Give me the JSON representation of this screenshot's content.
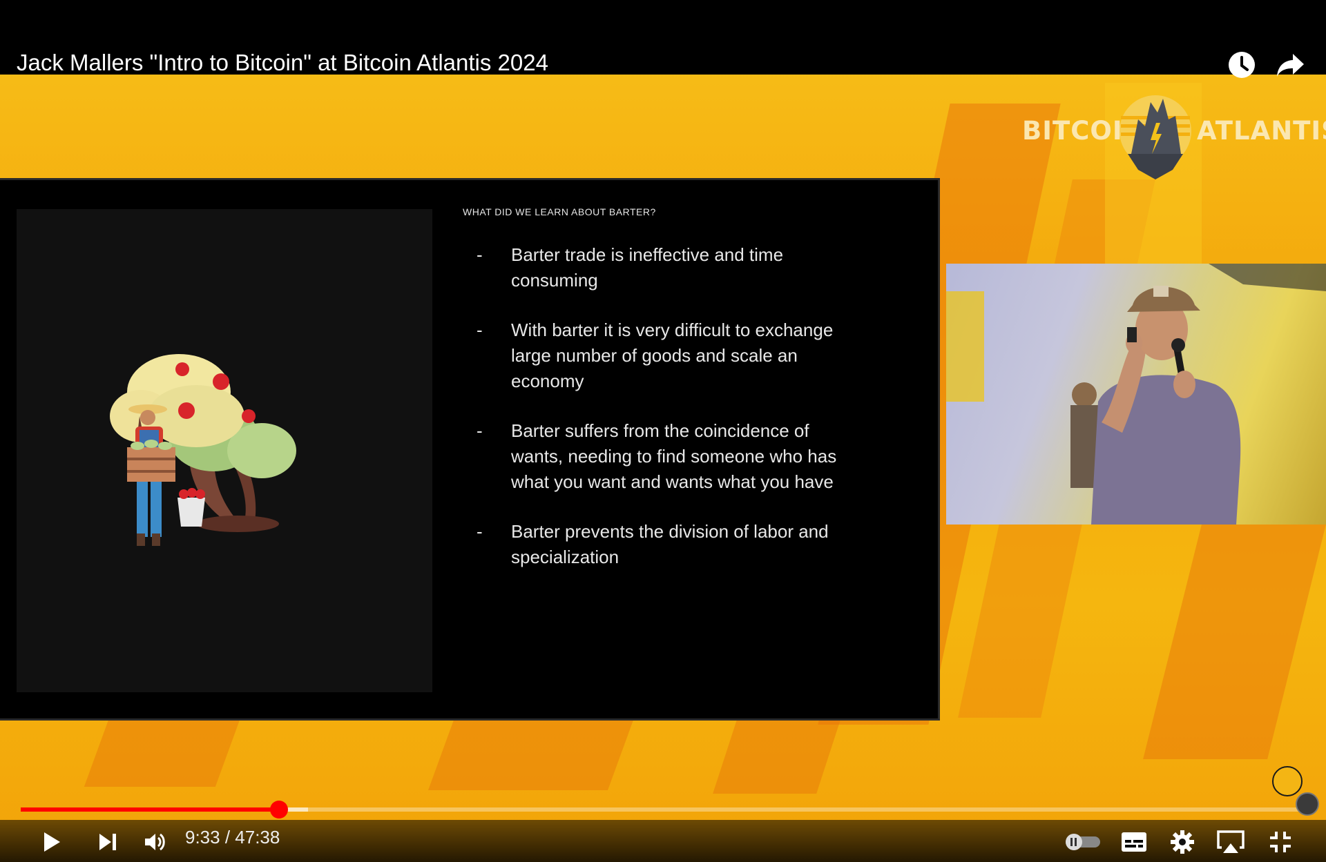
{
  "video": {
    "title": "Jack Mallers \"Intro to Bitcoin\" at Bitcoin Atlantis 2024",
    "logo_word_left": "BITCOIN",
    "logo_word_right": "ATLANTIS"
  },
  "slide": {
    "heading": "WHAT DID WE LEARN ABOUT BARTER?",
    "bullets": [
      "Barter trade is ineffective and time consuming",
      "With barter it is very difficult to exchange large number of goods and scale an economy",
      "Barter suffers from the coincidence of wants, needing to find someone who has what you want and wants what you have",
      "Barter prevents the division of labor and specialization"
    ],
    "bullet_marker": "-"
  },
  "player": {
    "time_display": "9:33 / 47:38",
    "progress_fraction": 0.2013,
    "buffered_fraction": 0.2235,
    "icons": [
      "watch-later-icon",
      "share-icon",
      "play-icon",
      "next-icon",
      "volume-icon",
      "autoplay-toggle-icon",
      "subtitles-icon",
      "settings-icon",
      "airplay-icon",
      "exit-fullscreen-icon"
    ]
  },
  "colors": {
    "progress": "#ff0000",
    "background_yellow": "#f4b30f",
    "slide_bg": "#000000"
  }
}
